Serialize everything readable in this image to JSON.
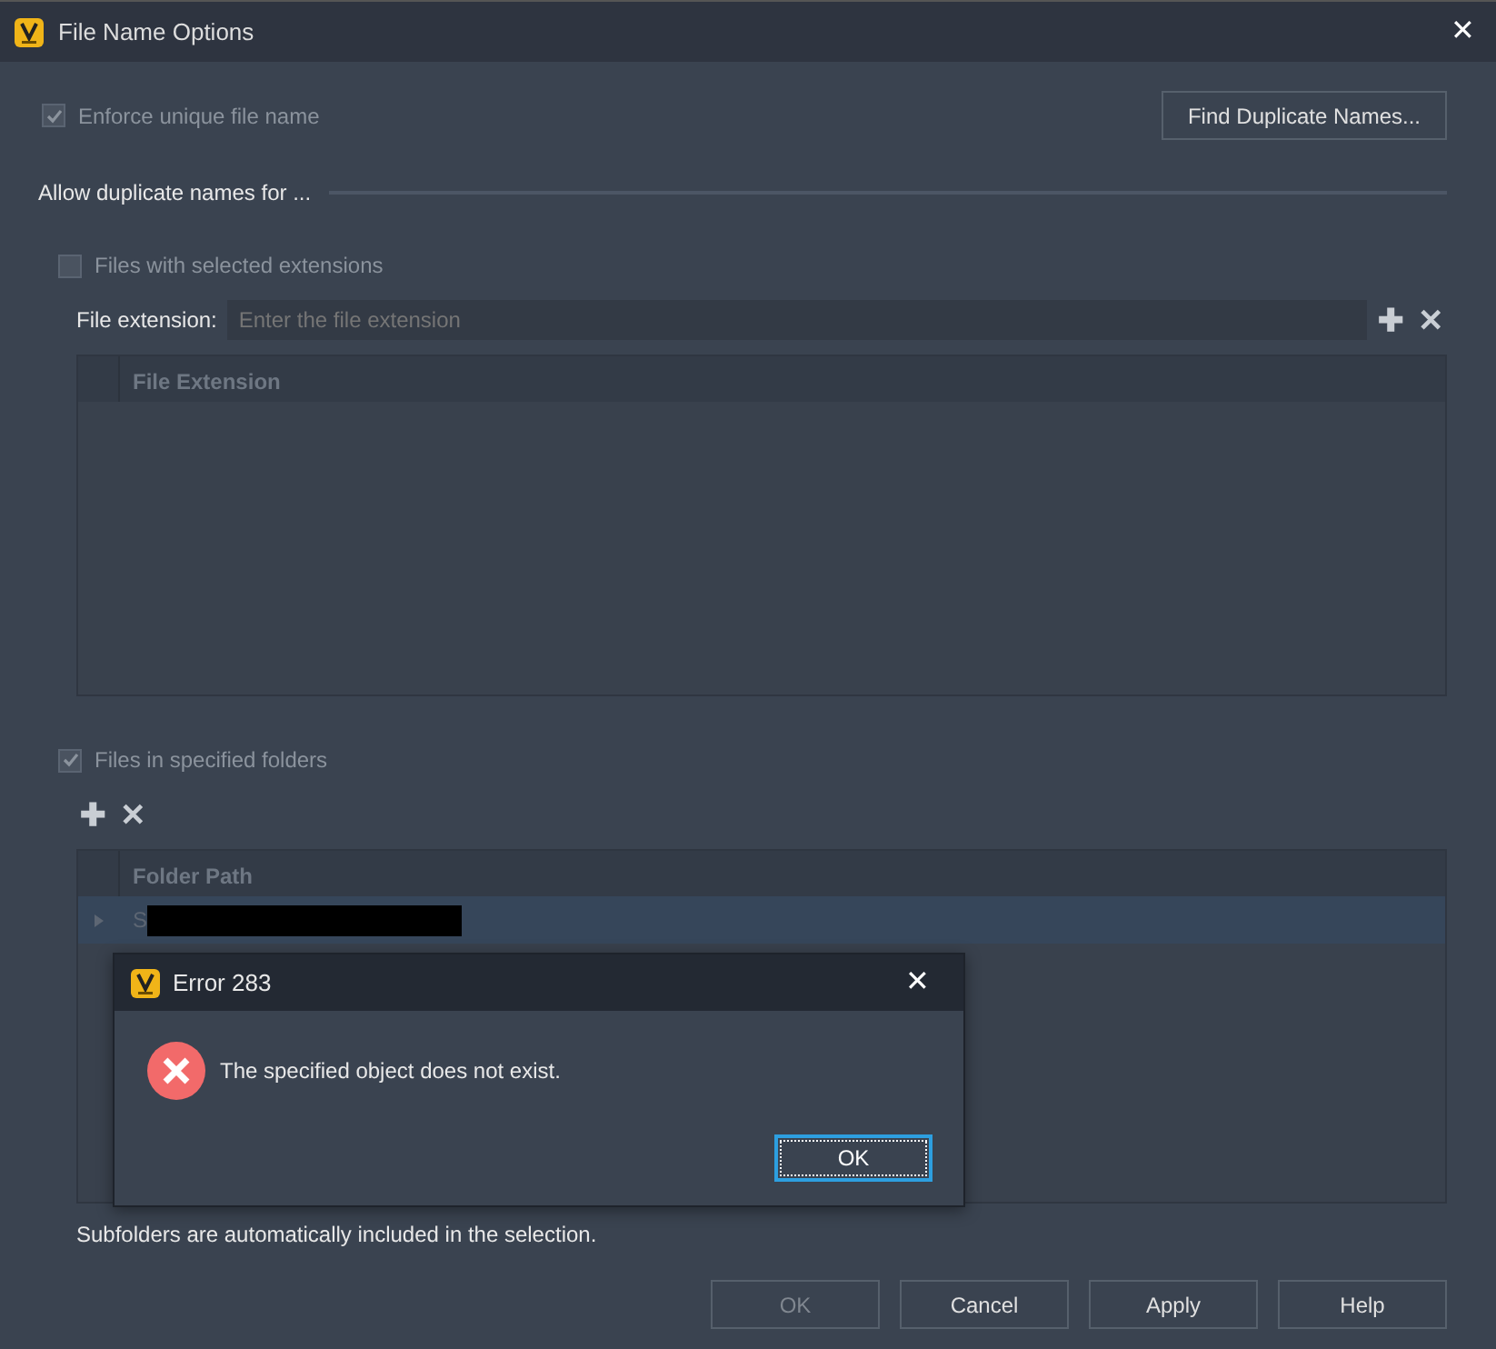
{
  "window": {
    "title": "File Name Options"
  },
  "enforce_unique": {
    "label": "Enforce unique file name",
    "checked": true,
    "disabled": true
  },
  "find_duplicates_button": "Find Duplicate Names...",
  "section_heading": "Allow duplicate names for ...",
  "extensions": {
    "label": "Files with selected extensions",
    "checked": false,
    "disabled": true,
    "field_label": "File extension:",
    "placeholder": "Enter the file extension",
    "add_symbol": "✚",
    "remove_symbol": "✕",
    "columns": [
      "File Extension"
    ]
  },
  "folders": {
    "label": "Files in specified folders",
    "checked": true,
    "disabled": true,
    "add_symbol": "✚",
    "remove_symbol": "✕",
    "columns": [
      "Folder Path"
    ],
    "rows": [
      {
        "path": "S",
        "redacted": true,
        "selected": true
      }
    ]
  },
  "note": "Subfolders are automatically included in the selection.",
  "buttons": [
    {
      "label": "OK",
      "disabled": true
    },
    {
      "label": "Cancel",
      "disabled": false
    },
    {
      "label": "Apply",
      "disabled": false
    },
    {
      "label": "Help",
      "disabled": false
    }
  ],
  "error_dialog": {
    "title": "Error 283",
    "close_symbol": "✕",
    "message": "The specified object does not exist.",
    "button": "OK"
  }
}
